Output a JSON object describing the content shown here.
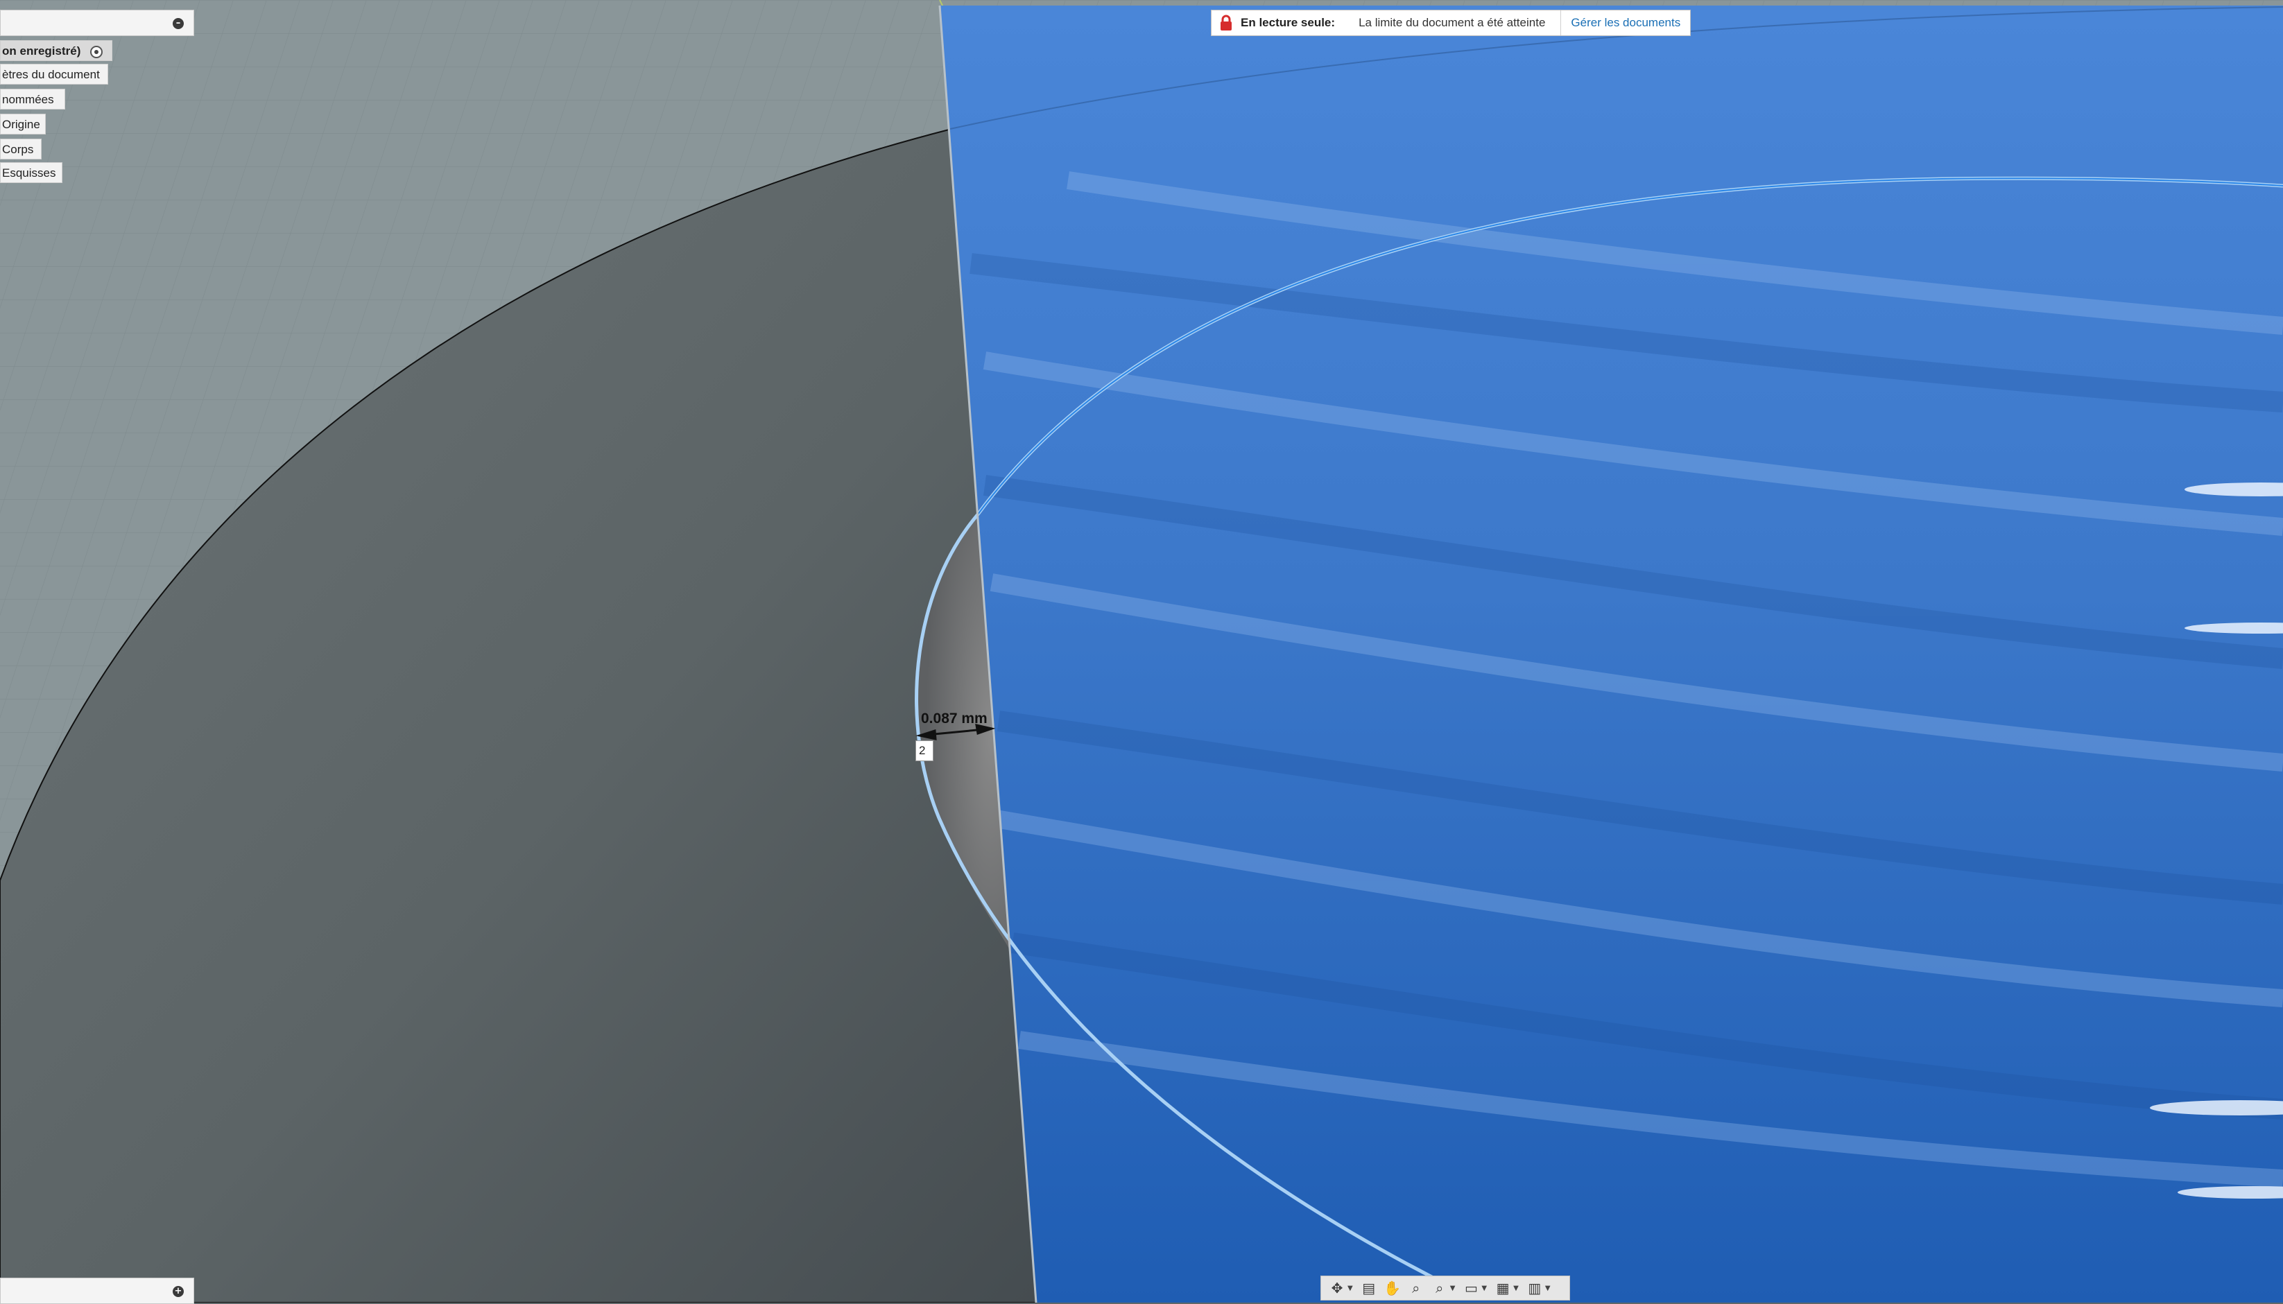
{
  "browser": {
    "items": [
      {
        "label": "on enregistré)",
        "kind": "document-root"
      },
      {
        "label": "ètres du document",
        "kind": "folder"
      },
      {
        "label": "nommées",
        "kind": "folder"
      },
      {
        "label": "Origine",
        "kind": "folder"
      },
      {
        "label": "Corps",
        "kind": "folder"
      },
      {
        "label": "Esquisses",
        "kind": "folder"
      }
    ]
  },
  "banner": {
    "label": "En lecture seule:",
    "message": "La limite du document a été atteinte",
    "link": "Gérer les documents",
    "icon": "lock-icon",
    "icon_color": "#d62d2d",
    "link_color": "#1a6fb5"
  },
  "sketch": {
    "dimension_text": "0.087 mm",
    "input_value": "2"
  },
  "navbar": {
    "tools": [
      {
        "name": "orbit-icon",
        "glyph": "✥"
      },
      {
        "name": "look-at-icon",
        "glyph": "▤"
      },
      {
        "name": "pan-icon",
        "glyph": "✋"
      },
      {
        "name": "zoom-icon",
        "glyph": "⌕"
      },
      {
        "name": "fit-icon",
        "glyph": "⌕"
      },
      {
        "name": "display-settings-icon",
        "glyph": "▭"
      },
      {
        "name": "grid-snaps-icon",
        "glyph": "▦"
      },
      {
        "name": "viewports-icon",
        "glyph": "▥"
      }
    ]
  },
  "colors": {
    "body_blue": "#3f7fd0",
    "sketch_plane": "#5f6769",
    "grid_background": "#8a9699",
    "selection_blue": "#9ec8f0"
  }
}
